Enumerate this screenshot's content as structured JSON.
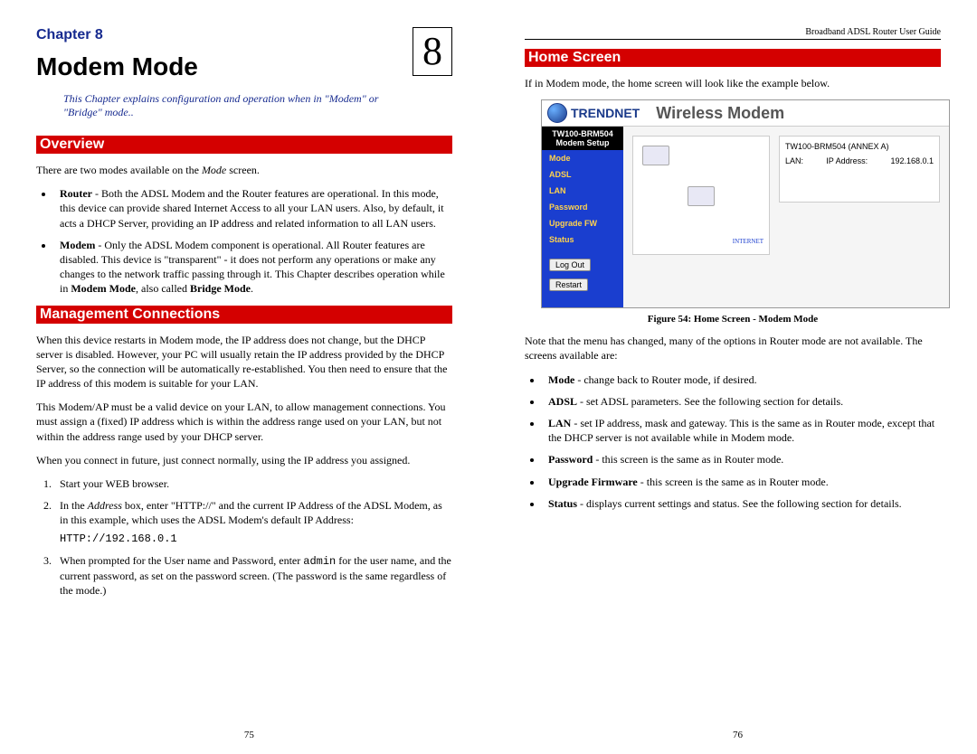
{
  "doc_header": "Broadband ADSL Router User Guide",
  "left": {
    "chapter_label": "Chapter 8",
    "chapter_num": "8",
    "title": "Modem Mode",
    "intro": "This Chapter explains configuration and  operation when in \"Modem\" or \"Bridge\" mode..",
    "h_overview": "Overview",
    "overview_p": "There are two modes available on the ",
    "overview_p_em": "Mode",
    "overview_p_end": " screen.",
    "bul1_term": "Router",
    "bul1_body": " - Both the ADSL Modem and the Router features are operational. In this mode, this device can provide shared Internet Access to all your LAN users. Also, by default, it acts a DHCP Server, providing an IP address and related information to all LAN users.",
    "bul2_term": "Modem",
    "bul2_body_a": " - Only the ADSL Modem component is operational. All Router features are disabled. This device is \"transparent\" - it does not perform any operations or make any changes to the network traffic passing through it. This Chapter describes operation while in ",
    "bul2_body_b": "Modem Mode",
    "bul2_body_c": ", also called ",
    "bul2_body_d": "Bridge Mode",
    "bul2_body_e": ".",
    "h_mgmt": "Management Connections",
    "mgmt_p1": "When this device restarts in Modem mode, the IP address does not change, but the DHCP server is disabled. However, your PC will usually retain the IP address provided by the DHCP Server, so the connection will be automatically re-established. You then need to ensure that the IP address of this modem is suitable for your LAN.",
    "mgmt_p2": "This Modem/AP must be a valid device on your LAN, to allow management connections. You must assign a (fixed) IP address which is within the address range used on your LAN, but not within the address range used by your DHCP server.",
    "mgmt_p3": "When you connect in future, just connect normally, using the IP address you assigned.",
    "ol1": "Start your WEB browser.",
    "ol2_a": "In the ",
    "ol2_b": "Address",
    "ol2_c": " box, enter \"HTTP://\" and the current IP Address of the ADSL Modem, as in this example, which uses the ADSL Modem's default IP Address:",
    "ol2_code": "HTTP://192.168.0.1",
    "ol3_a": "When prompted for the User name and Password, enter ",
    "ol3_b": "admin",
    "ol3_c": " for the user name, and the current password, as set on the password screen. (The password is the same regardless of the mode.)",
    "page_num": "75"
  },
  "right": {
    "h_home": "Home Screen",
    "home_p": "If in Modem mode, the home screen will look like the example below.",
    "ss": {
      "brand": "TRENDNET",
      "title": "Wireless Modem",
      "model_a": "TW100-BRM504",
      "model_b": "Modem Setup",
      "nav": {
        "mode": "Mode",
        "adsl": "ADSL",
        "lan": "LAN",
        "password": "Password",
        "upgrade": "Upgrade FW",
        "status": "Status"
      },
      "btn_logout": "Log Out",
      "btn_restart": "Restart",
      "info_title": "TW100-BRM504 (ANNEX A)",
      "info_lan": "LAN:",
      "info_ip_lbl": "IP Address:",
      "info_ip": "192.168.0.1",
      "internet_lbl": "INTERNET"
    },
    "fig_caption": "Figure 54: Home Screen - Modem Mode",
    "note_p": "Note that the menu has changed, many of the options in Router mode are not available. The screens available are:",
    "items": {
      "mode_t": "Mode",
      "mode_b": " - change back to Router mode, if desired.",
      "adsl_t": "ADSL",
      "adsl_b": " - set ADSL parameters. See the following section for details.",
      "lan_t": "LAN",
      "lan_b": " - set IP address, mask and gateway. This is the same as in Router mode, except that the DHCP server is not available while in Modem mode.",
      "pw_t": "Password",
      "pw_b": " - this screen is the same as in Router mode.",
      "fw_t": "Upgrade Firmware",
      "fw_b": " - this screen is the same as in Router mode.",
      "st_t": "Status",
      "st_b": " - displays current settings and status. See the following section for details."
    },
    "page_num": "76"
  }
}
